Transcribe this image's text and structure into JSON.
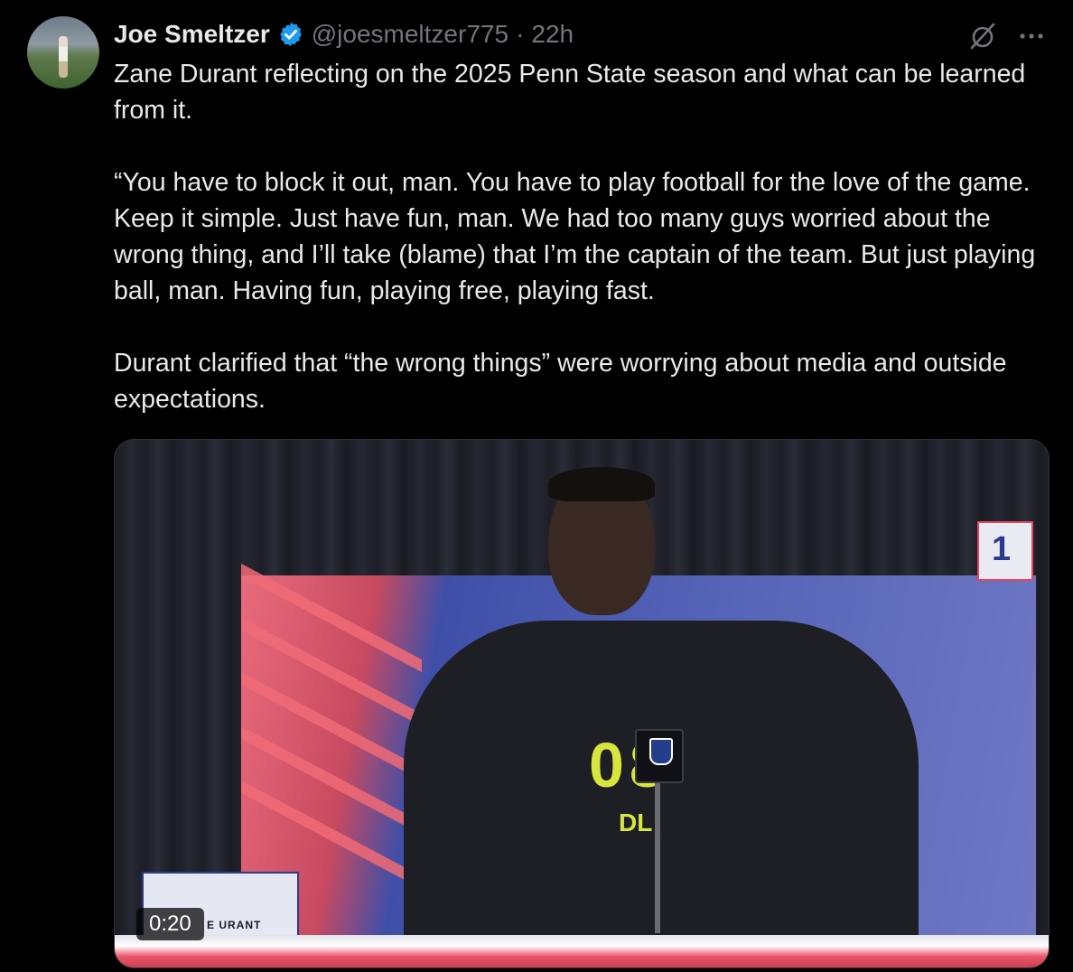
{
  "post": {
    "author": {
      "display_name": "Joe Smeltzer",
      "handle": "@joesmeltzer775",
      "verified": true,
      "avatar_icon": "profile-photo"
    },
    "separator": "·",
    "timestamp": "22h",
    "paragraphs": [
      "Zane Durant reflecting on the 2025 Penn State season and what can be learned from it.",
      "“You have to block it out, man. You have to play football for the love of the game. Keep it simple. Just have fun, man. We had too many guys worried about the wrong thing, and I’ll take (blame) that I’m the captain of the team. But just playing ball, man. Having fun, playing free, playing fast.",
      "Durant clarified that “the wrong things” were worrying about media and outside expectations."
    ],
    "actions": {
      "grok_icon": "grok-slash-icon",
      "more_icon": "more-horizontal-icon"
    },
    "media": {
      "type": "video",
      "duration": "0:20",
      "jersey_number": "08",
      "jersey_position": "DL",
      "nameplate_text": "E URANT",
      "corner_sign_number": "1",
      "mic_logo_text": "NFL"
    }
  },
  "colors": {
    "background": "#000000",
    "text_primary": "#e7e9ea",
    "text_secondary": "#71767b",
    "verified_blue": "#1d9bf0",
    "border": "#2f3336"
  }
}
